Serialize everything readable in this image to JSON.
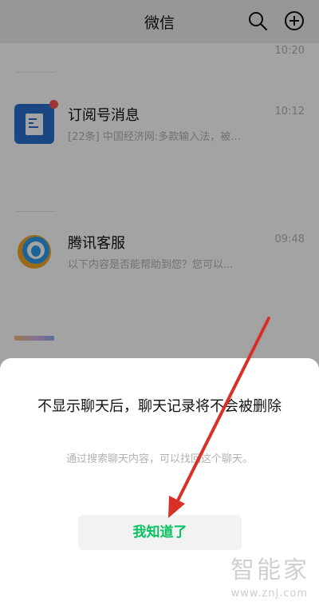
{
  "header": {
    "title": "微信",
    "icons": [
      "search-icon",
      "add-icon"
    ]
  },
  "chat_list": {
    "top_time": "10:20",
    "items": [
      {
        "name": "订阅号消息",
        "preview": "[22条] 中国经济网:多款输入法，被...",
        "time": "10:12",
        "avatar_icon": "subscription-icon",
        "unread_dot": true
      },
      {
        "name": "腾讯客服",
        "preview": "以下内容是否能帮助到您？您可以...",
        "time": "09:48",
        "avatar_icon": "tencent-service-icon",
        "unread_dot": false
      }
    ]
  },
  "dialog": {
    "message": "不显示聊天后，聊天记录将不会被删除",
    "hint": "通过搜索聊天内容，可以找回这个聊天。",
    "button_label": "我知道了"
  },
  "watermark": {
    "text": "智能家",
    "url": "www.znj.com"
  },
  "colors": {
    "accent_green": "#07c160",
    "annotation_red": "#d93025",
    "unread_red": "#fa5151"
  }
}
